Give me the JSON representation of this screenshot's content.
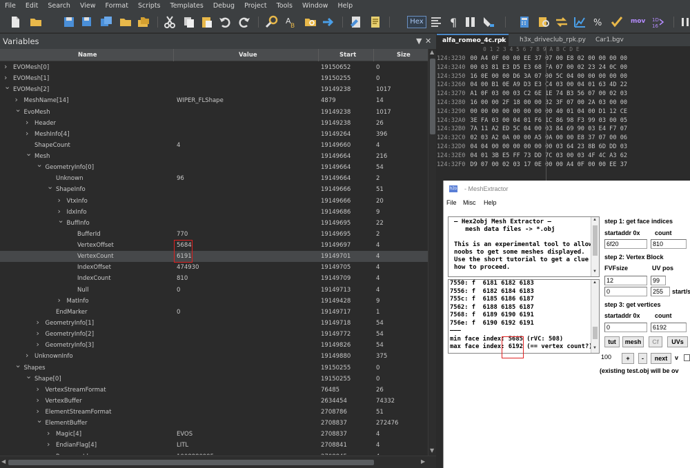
{
  "menubar": [
    "File",
    "Edit",
    "Search",
    "View",
    "Format",
    "Scripts",
    "Templates",
    "Debug",
    "Project",
    "Tools",
    "Window",
    "Help"
  ],
  "toolbar": {
    "hex_label": "Hex",
    "mov_label": "mov",
    "hex_sub": "1D\n16"
  },
  "variables": {
    "title": "Variables",
    "columns": {
      "name": "Name",
      "value": "Value",
      "start": "Start",
      "size": "Size"
    },
    "rows": [
      {
        "indent": 0,
        "arrow": "right",
        "name": "EVOMesh[0]",
        "value": "",
        "start": "19150652",
        "size": "0"
      },
      {
        "indent": 0,
        "arrow": "right",
        "name": "EVOMesh[1]",
        "value": "",
        "start": "19150255",
        "size": "0"
      },
      {
        "indent": 0,
        "arrow": "down",
        "name": "EVOMesh[2]",
        "value": "",
        "start": "19149238",
        "size": "1017"
      },
      {
        "indent": 1,
        "arrow": "right",
        "name": "MeshName[14]",
        "value": "WIPER_FLShape",
        "start": "4879",
        "size": "14"
      },
      {
        "indent": 1,
        "arrow": "down",
        "name": "EvoMesh",
        "value": "",
        "start": "19149238",
        "size": "1017"
      },
      {
        "indent": 2,
        "arrow": "right",
        "name": "Header",
        "value": "",
        "start": "19149238",
        "size": "26"
      },
      {
        "indent": 2,
        "arrow": "right",
        "name": "MeshInfo[4]",
        "value": "",
        "start": "19149264",
        "size": "396"
      },
      {
        "indent": 2,
        "arrow": "",
        "name": "ShapeCount",
        "value": "4",
        "start": "19149660",
        "size": "4"
      },
      {
        "indent": 2,
        "arrow": "down",
        "name": "Mesh",
        "value": "",
        "start": "19149664",
        "size": "216"
      },
      {
        "indent": 3,
        "arrow": "down",
        "name": "GeometryInfo[0]",
        "value": "",
        "start": "19149664",
        "size": "54"
      },
      {
        "indent": 4,
        "arrow": "",
        "name": "Unknown",
        "value": "96",
        "start": "19149664",
        "size": "2"
      },
      {
        "indent": 4,
        "arrow": "down",
        "name": "ShapeInfo",
        "value": "",
        "start": "19149666",
        "size": "51"
      },
      {
        "indent": 5,
        "arrow": "right",
        "name": "VtxInfo",
        "value": "",
        "start": "19149666",
        "size": "20"
      },
      {
        "indent": 5,
        "arrow": "right",
        "name": "IdxInfo",
        "value": "",
        "start": "19149686",
        "size": "9"
      },
      {
        "indent": 5,
        "arrow": "down",
        "name": "BuffInfo",
        "value": "",
        "start": "19149695",
        "size": "22"
      },
      {
        "indent": 6,
        "arrow": "",
        "name": "BufferId",
        "value": "770",
        "start": "19149695",
        "size": "2"
      },
      {
        "indent": 6,
        "arrow": "",
        "name": "VertexOffset",
        "value": "5684",
        "start": "19149697",
        "size": "4"
      },
      {
        "indent": 6,
        "arrow": "",
        "name": "VertexCount",
        "value": "6191",
        "start": "19149701",
        "size": "4",
        "selected": true
      },
      {
        "indent": 6,
        "arrow": "",
        "name": "IndexOffset",
        "value": "474930",
        "start": "19149705",
        "size": "4"
      },
      {
        "indent": 6,
        "arrow": "",
        "name": "IndexCount",
        "value": "810",
        "start": "19149709",
        "size": "4"
      },
      {
        "indent": 6,
        "arrow": "",
        "name": "Null",
        "value": "0",
        "start": "19149713",
        "size": "4"
      },
      {
        "indent": 5,
        "arrow": "right",
        "name": "MatInfo",
        "value": "",
        "start": "19149428",
        "size": "9"
      },
      {
        "indent": 4,
        "arrow": "",
        "name": "EndMarker",
        "value": "0",
        "start": "19149717",
        "size": "1"
      },
      {
        "indent": 3,
        "arrow": "right",
        "name": "GeometryInfo[1]",
        "value": "",
        "start": "19149718",
        "size": "54"
      },
      {
        "indent": 3,
        "arrow": "right",
        "name": "GeometryInfo[2]",
        "value": "",
        "start": "19149772",
        "size": "54"
      },
      {
        "indent": 3,
        "arrow": "right",
        "name": "GeometryInfo[3]",
        "value": "",
        "start": "19149826",
        "size": "54"
      },
      {
        "indent": 2,
        "arrow": "right",
        "name": "UnknownInfo",
        "value": "",
        "start": "19149880",
        "size": "375"
      },
      {
        "indent": 1,
        "arrow": "down",
        "name": "Shapes",
        "value": "",
        "start": "19150255",
        "size": "0"
      },
      {
        "indent": 2,
        "arrow": "down",
        "name": "Shape[0]",
        "value": "",
        "start": "19150255",
        "size": "0"
      },
      {
        "indent": 3,
        "arrow": "right",
        "name": "VertexStreamFormat",
        "value": "",
        "start": "76485",
        "size": "26"
      },
      {
        "indent": 3,
        "arrow": "right",
        "name": "VertexBuffer",
        "value": "",
        "start": "2634454",
        "size": "74332"
      },
      {
        "indent": 3,
        "arrow": "right",
        "name": "ElementStreamFormat",
        "value": "",
        "start": "2708786",
        "size": "51"
      },
      {
        "indent": 3,
        "arrow": "down",
        "name": "ElementBuffer",
        "value": "",
        "start": "2708837",
        "size": "272476"
      },
      {
        "indent": 4,
        "arrow": "right",
        "name": "Magic[4]",
        "value": "EVOS",
        "start": "2708837",
        "size": "4"
      },
      {
        "indent": 4,
        "arrow": "right",
        "name": "EndianFlag[4]",
        "value": "LITL",
        "start": "2708841",
        "size": "4"
      },
      {
        "indent": 4,
        "arrow": "",
        "name": "ResourceId",
        "value": "1008880995",
        "start": "2708845",
        "size": "4"
      }
    ]
  },
  "tabs": [
    {
      "label": "alfa_romeo_4c.rpk",
      "active": true,
      "close": "✕"
    },
    {
      "label": "h3x_driveclub_rpk.py",
      "active": false
    },
    {
      "label": "Car1.bgv",
      "active": false
    }
  ],
  "hex": {
    "column_header": "0  1  2  3  4  5  6  7  8  9  A  B  C  D  E",
    "rows": [
      {
        "addr": "124:3230",
        "bytes": "00 A4 0F 00 00 EE 37 07 00 E8 02 00 00 00 00"
      },
      {
        "addr": "124:3240",
        "bytes": "00 03 81 E3 D5 E3 68 FA 07 00 02 23 24 0C 00"
      },
      {
        "addr": "124:3250",
        "bytes": "16 0E 00 00 D6 3A 07 00 5C 04 00 00 00 00 00"
      },
      {
        "addr": "124:3260",
        "bytes": "04 00 B1 0E A9 D3 E3 C4 03 00 04 01 63 4D 22"
      },
      {
        "addr": "124:3270",
        "bytes": "A1 0F 03 00 03 C2 6E 1E 74 B3 56 07 00 02 03"
      },
      {
        "addr": "124:3280",
        "bytes": "16 00 00 2F 18 00 00 32 3F 07 00 2A 03 00 00"
      },
      {
        "addr": "124:3290",
        "bytes": "00 00 00 00 00 00 00 00 40 01 04 00 D1 12 CE"
      },
      {
        "addr": "124:32A0",
        "bytes": "3E FA 03 00 04 01 F6 1C 86 98 F3 99 03 00 05"
      },
      {
        "addr": "124:32B0",
        "bytes": "7A 11 A2 ED 5C 04 00 03 84 69 90 03 E4 F7 07"
      },
      {
        "addr": "124:32C0",
        "bytes": "02 03 A2 0A 00 00 A5 0A 00 00 E8 37 07 00 06"
      },
      {
        "addr": "124:32D0",
        "bytes": "04 04 00 00 00 00 00 00 03 64 23 8B 6D DD 03"
      },
      {
        "addr": "124:32E0",
        "bytes": "04 01 3B E5 FF 73 DD 7C 03 00 03 4F 4C A3 62"
      },
      {
        "addr": "124:32F0",
        "bytes": "D9 07 00 02 03 17 0E 00 00 A4 0F 00 00 EE 37"
      }
    ]
  },
  "mesh": {
    "title": "- MeshExtractor",
    "logo": "h2o",
    "menu": [
      "File",
      "Misc",
      "Help"
    ],
    "info_lines": [
      "— Hex2obj Mesh Extractor —",
      "   mesh data files -> *.obj",
      "",
      "This is an experimental tool to allow",
      "noobs to get some meshes displayed.",
      "Use the short tutorial to get a clue on",
      "how to proceed."
    ],
    "output_lines": [
      "7550: f  6181 6182 6183",
      "7556: f  6182 6184 6183",
      "755c: f  6185 6186 6187",
      "7562: f  6188 6185 6187",
      "7568: f  6189 6190 6191",
      "756e: f  6190 6192 6191",
      "———",
      "min face index: 5685 (rVC: 508)",
      "max face index: 6192 (== vertex count?)"
    ],
    "step1": {
      "label": "step 1: get face indices",
      "startaddr_label": "startaddr 0x",
      "count_label": "count",
      "startaddr": "6f20",
      "count": "810"
    },
    "step2": {
      "label": "step 2: Vertex Block",
      "fvf_label": "FVFsize",
      "uv_label": "UV pos",
      "fvf": "12",
      "uv": "99",
      "v3": "0",
      "v4": "255",
      "start_label": "start/s"
    },
    "step3": {
      "label": "step 3: get vertices",
      "startaddr_label": "startaddr 0x",
      "count_label": "count",
      "startaddr": "0",
      "count": "6192"
    },
    "buttons": {
      "tut": "tut",
      "mesh": "mesh",
      "cf": "Cf",
      "uvs": "UVs",
      "plus": "+",
      "minus": "-",
      "next": "next",
      "v": "v"
    },
    "zoom": "100",
    "note": "(existing test.obj will be ov"
  }
}
